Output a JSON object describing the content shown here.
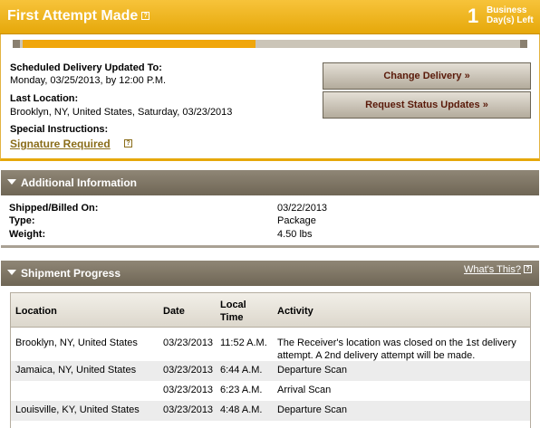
{
  "header": {
    "title": "First Attempt Made",
    "days_left_number": "1",
    "days_left_line1": "Business",
    "days_left_line2": "Day(s) Left",
    "help_glyph": "?"
  },
  "progress": {
    "fraction": 0.47
  },
  "status": {
    "scheduled_label": "Scheduled Delivery Updated To:",
    "scheduled_value": "Monday, 03/25/2013, by 12:00 P.M.",
    "last_location_label": "Last Location:",
    "last_location_value": "Brooklyn, NY, United States, Saturday, 03/23/2013",
    "special_label": "Special Instructions:",
    "special_link": "Signature Required",
    "change_delivery_button": "Change Delivery »",
    "request_updates_button": "Request Status Updates »"
  },
  "additional": {
    "title": "Additional Information",
    "rows": [
      {
        "label": "Shipped/Billed On:",
        "value": "03/22/2013"
      },
      {
        "label": "Type:",
        "value": "Package"
      },
      {
        "label": "Weight:",
        "value": "4.50 lbs"
      }
    ]
  },
  "shipment_progress": {
    "title": "Shipment Progress",
    "whats_this": "What's This?",
    "columns": {
      "location": "Location",
      "date": "Date",
      "time_1": "Local",
      "time_2": "Time",
      "activity": "Activity"
    },
    "rows": [
      {
        "location": "Brooklyn, NY, United States",
        "date": "03/23/2013",
        "time": "11:52 A.M.",
        "activity_1": "The Receiver's location was closed on the 1st delivery",
        "activity_2": "attempt. A 2nd delivery attempt will be made."
      },
      {
        "location": "Jamaica, NY, United States",
        "date": "03/23/2013",
        "time": "6:44 A.M.",
        "activity_1": "Departure Scan",
        "activity_2": ""
      },
      {
        "location": "",
        "date": "03/23/2013",
        "time": "6:23 A.M.",
        "activity_1": "Arrival Scan",
        "activity_2": ""
      },
      {
        "location": "Louisville, KY, United States",
        "date": "03/23/2013",
        "time": "4:48 A.M.",
        "activity_1": "Departure Scan",
        "activity_2": ""
      }
    ]
  },
  "colors": {
    "accent": "#e6a80a",
    "bar": "#7a7160",
    "link": "#8a6d1a"
  }
}
